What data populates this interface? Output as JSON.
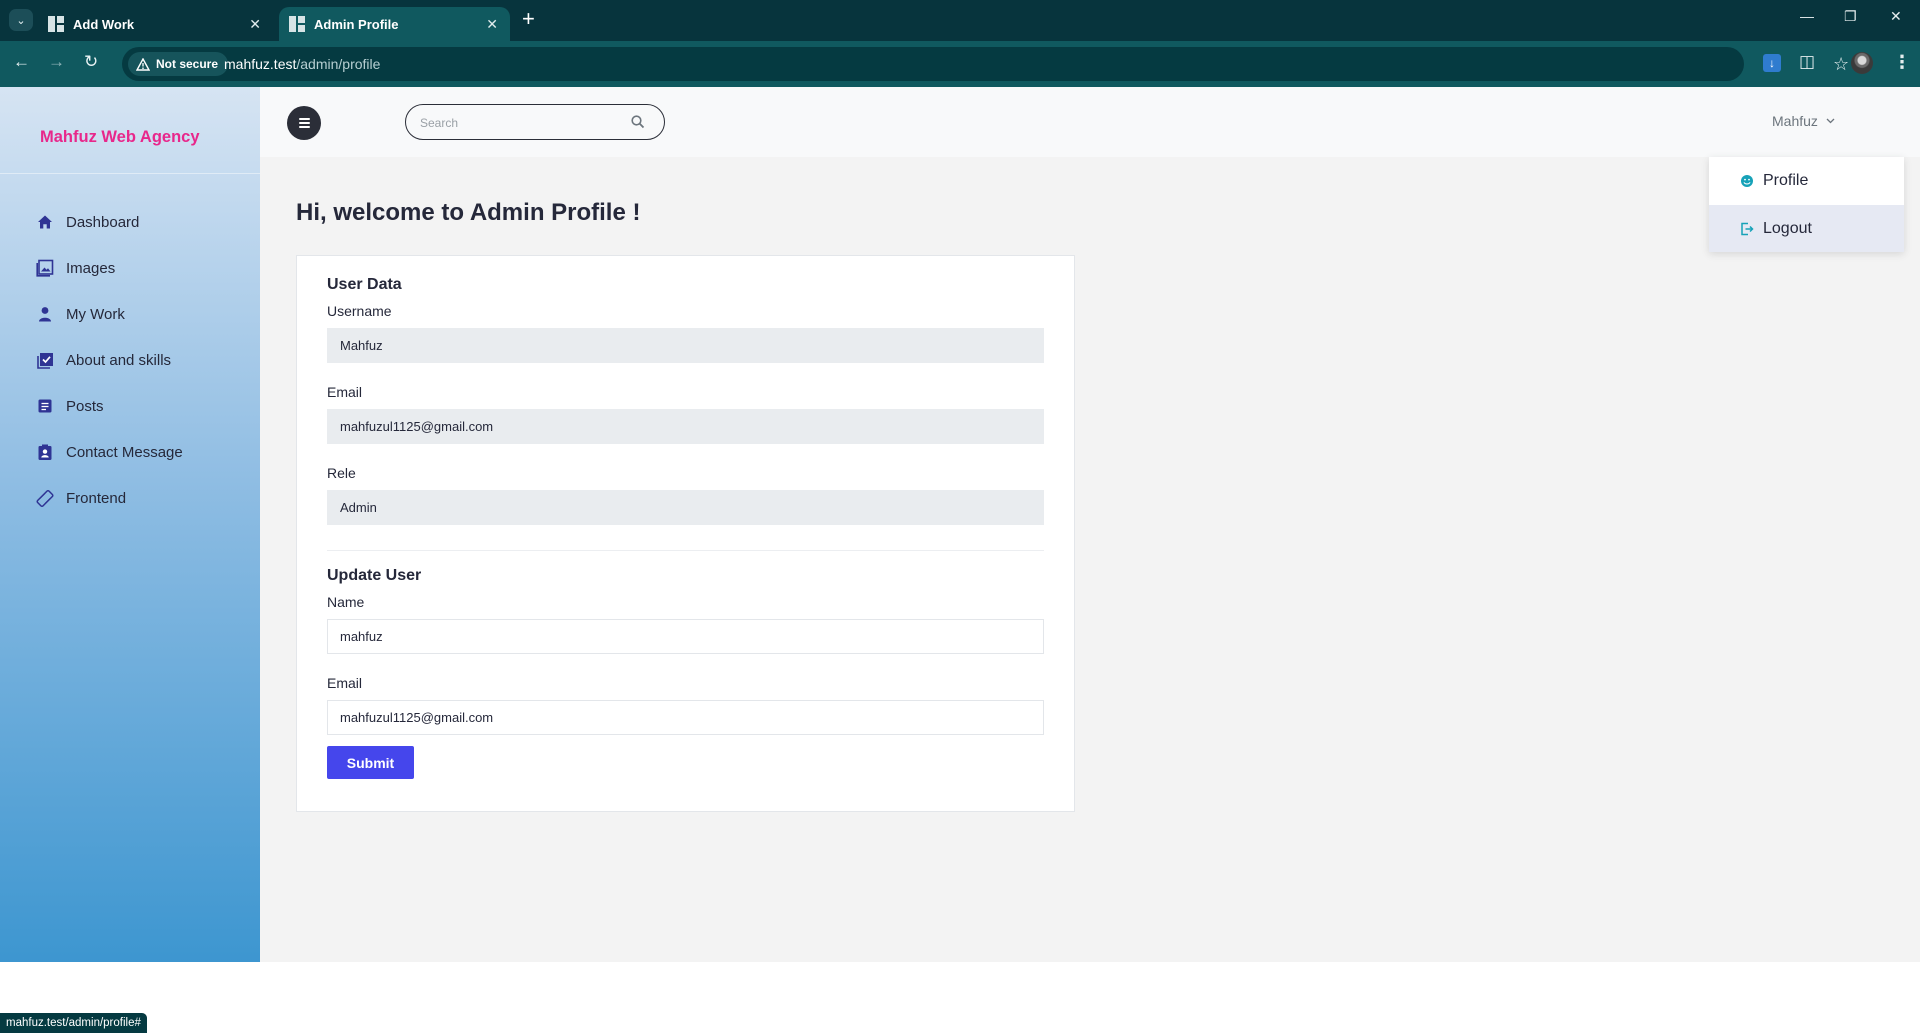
{
  "browser": {
    "tabs": [
      {
        "title": "Add Work",
        "active": false
      },
      {
        "title": "Admin Profile",
        "active": true
      }
    ],
    "security_label": "Not secure",
    "url_host": "mahfuz.test",
    "url_path": "/admin/profile",
    "status_url": "mahfuz.test/admin/profile#"
  },
  "sidebar": {
    "brand": "Mahfuz Web Agency",
    "brand_color": "#e8278b",
    "items": [
      {
        "label": "Dashboard",
        "icon": "home-icon"
      },
      {
        "label": "Images",
        "icon": "images-icon"
      },
      {
        "label": "My Work",
        "icon": "user-icon"
      },
      {
        "label": "About and skills",
        "icon": "check-square-icon"
      },
      {
        "label": "Posts",
        "icon": "document-icon"
      },
      {
        "label": "Contact Message",
        "icon": "contact-card-icon"
      },
      {
        "label": "Frontend",
        "icon": "frontend-icon"
      }
    ]
  },
  "topbar": {
    "search_placeholder": "Search",
    "user_name": "Mahfuz"
  },
  "user_dropdown": {
    "items": [
      {
        "label": "Profile",
        "icon": "profile-icon"
      },
      {
        "label": "Logout",
        "icon": "logout-icon"
      }
    ]
  },
  "main": {
    "welcome": "Hi, welcome to Admin Profile !",
    "user_data": {
      "title": "User Data",
      "username_label": "Username",
      "username": "Mahfuz",
      "email_label": "Email",
      "email": "mahfuzul1125@gmail.com",
      "role_label": "Rele",
      "role": "Admin"
    },
    "update_user": {
      "title": "Update User",
      "name_label": "Name",
      "name": "mahfuz",
      "email_label": "Email",
      "email": "mahfuzul1125@gmail.com",
      "submit_label": "Submit"
    }
  },
  "colors": {
    "accent_button": "#4546ec",
    "browser_chrome": "#10595f",
    "icon_accent": "#2f3494"
  }
}
